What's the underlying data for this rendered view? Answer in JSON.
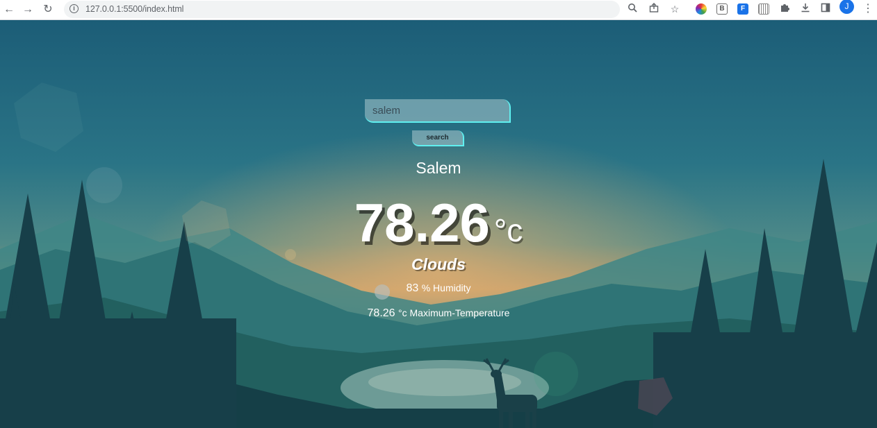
{
  "browser": {
    "url": "127.0.0.1:5500/index.html",
    "profile_initial": "J"
  },
  "search": {
    "value": "salem",
    "button_label": "search"
  },
  "weather": {
    "city": "Salem",
    "temperature": "78.26",
    "temperature_unit": "°c",
    "condition": "Clouds",
    "humidity_value": "83",
    "humidity_label": "% Humidity",
    "max_temp_value": "78.26",
    "max_temp_label": "°c Maximum-Temperature"
  },
  "colors": {
    "accent": "#5ff0f0",
    "sky_top": "#1d5f78",
    "glow": "#d9a868"
  }
}
